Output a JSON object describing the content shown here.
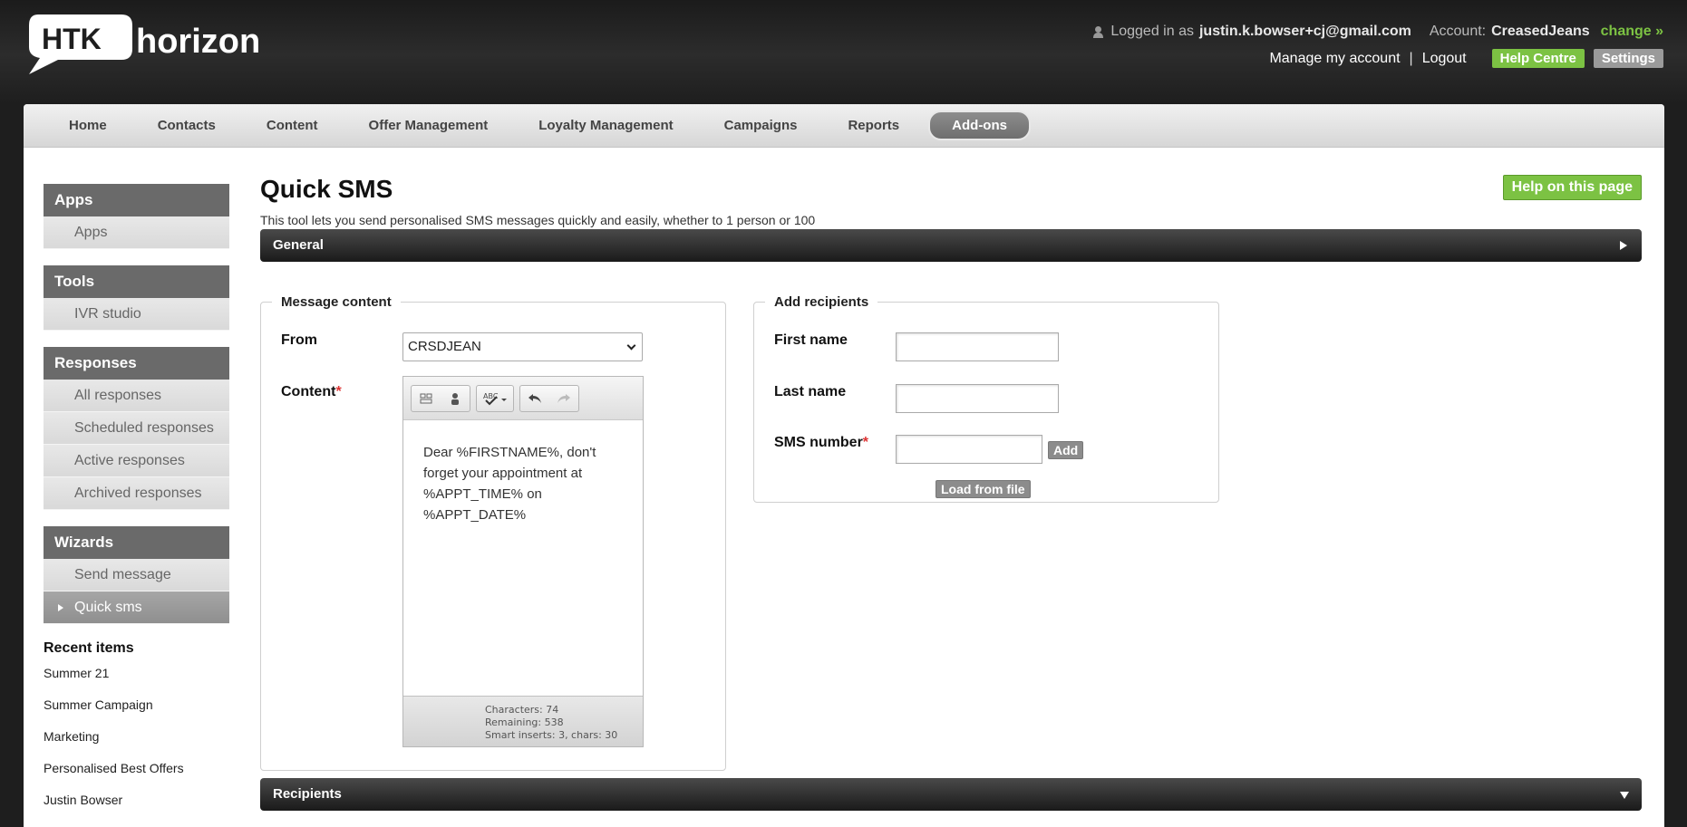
{
  "header": {
    "logo_prefix": "HTK",
    "logo_suffix": "horizon",
    "logged_in_label": "Logged in as",
    "user_email": "justin.k.bowser+cj@gmail.com",
    "account_label": "Account:",
    "account_name": "CreasedJeans",
    "change_label": "change »",
    "manage_account": "Manage my account",
    "separator": "|",
    "logout": "Logout",
    "help_centre": "Help Centre",
    "settings": "Settings",
    "icons": {
      "user": "user-icon"
    }
  },
  "nav": {
    "items": [
      "Home",
      "Contacts",
      "Content",
      "Offer Management",
      "Loyalty Management",
      "Campaigns",
      "Reports",
      "Add-ons"
    ],
    "active": "Add-ons"
  },
  "sidebar": {
    "groups": [
      {
        "title": "Apps",
        "items": [
          "Apps"
        ]
      },
      {
        "title": "Tools",
        "items": [
          "IVR studio"
        ]
      },
      {
        "title": "Responses",
        "items": [
          "All responses",
          "Scheduled responses",
          "Active responses",
          "Archived responses"
        ]
      },
      {
        "title": "Wizards",
        "items": [
          "Send message",
          "Quick sms"
        ],
        "active": "Quick sms"
      }
    ],
    "recent_title": "Recent items",
    "recent_items": [
      "Summer 21",
      "Summer Campaign",
      "Marketing",
      "Personalised Best Offers",
      "Justin Bowser"
    ]
  },
  "main": {
    "title": "Quick SMS",
    "help_button": "Help on this page",
    "intro": "This tool lets you send personalised SMS messages quickly and easily, whether to 1 person or 100",
    "general_section": "General",
    "recipients_section": "Recipients",
    "message_content": {
      "legend": "Message content",
      "from_label": "From",
      "from_value": "CRSDJEAN",
      "content_label": "Content",
      "required_mark": "*",
      "content_lines": [
        "Dear %FIRSTNAME%, don't",
        "forget your appointment at",
        "%APPT_TIME% on",
        "%APPT_DATE%"
      ],
      "characters": "Characters: 74",
      "remaining": "Remaining: 538",
      "smart_inserts": "Smart inserts: 3, chars: 30"
    },
    "add_recipients": {
      "legend": "Add recipients",
      "first_name_label": "First name",
      "first_name_value": "",
      "last_name_label": "Last name",
      "last_name_value": "",
      "sms_number_label": "SMS number",
      "required_mark": "*",
      "sms_number_value": "",
      "add_button": "Add",
      "load_button": "Load from file"
    }
  },
  "colors": {
    "accent_green": "#7cc243",
    "dark_header": "#1e1e1e",
    "sidebar_head": "#6a6a6a"
  }
}
